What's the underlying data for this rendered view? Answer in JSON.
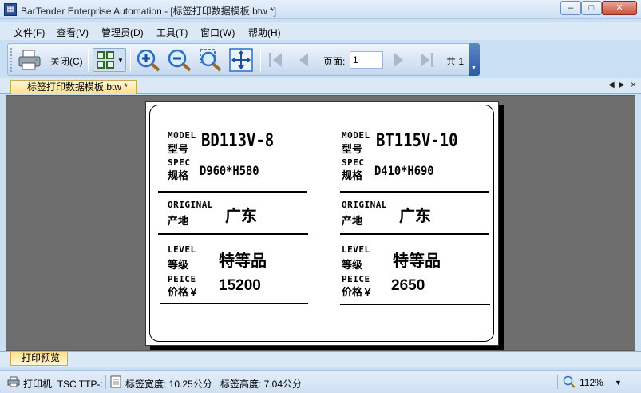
{
  "window": {
    "title": "BarTender Enterprise Automation - [标签打印数据模板.btw *]",
    "app_icon": "bartender-app-icon",
    "minimize": "–",
    "maximize": "□",
    "close": "✕"
  },
  "menu": {
    "items": [
      {
        "label": "文件(F)"
      },
      {
        "label": "查看(V)"
      },
      {
        "label": "管理员(D)"
      },
      {
        "label": "工具(T)"
      },
      {
        "label": "窗口(W)"
      },
      {
        "label": "帮助(H)"
      }
    ]
  },
  "toolbar": {
    "close_label": "关闭(C)",
    "page_label": "页面:",
    "page_value": "1",
    "total_label": "共 1",
    "icons": [
      "print-icon",
      "layout-grid-icon",
      "zoom-in-icon",
      "zoom-out-icon",
      "zoom-fit-icon",
      "fit-page-icon",
      "first-page-icon",
      "prev-page-icon",
      "next-page-icon",
      "last-page-icon"
    ]
  },
  "doc_tab": {
    "label": "标签打印数据模板.btw *"
  },
  "label": {
    "left": {
      "model_en": "MODEL",
      "model_cn": "型号",
      "model_value": "BD113V-8",
      "spec_en": "SPEC",
      "spec_cn": "规格",
      "spec_value": "D960*H580",
      "origin_en": "ORIGINAL",
      "origin_cn": "产地",
      "origin_value": "广东",
      "level_en": "LEVEL",
      "level_cn": "等级",
      "level_value": "特等品",
      "price_en": "PEICE",
      "price_cn": "价格￥",
      "price_value": "15200"
    },
    "right": {
      "model_en": "MODEL",
      "model_cn": "型号",
      "model_value": "BT115V-10",
      "spec_en": "SPEC",
      "spec_cn": "规格",
      "spec_value": "D410*H690",
      "origin_en": "ORIGINAL",
      "origin_cn": "产地",
      "origin_value": "广东",
      "level_en": "LEVEL",
      "level_cn": "等级",
      "level_value": "特等品",
      "price_en": "PEICE",
      "price_cn": "价格￥",
      "price_value": "2650"
    }
  },
  "bottom_tab": {
    "label": "打印预览"
  },
  "status": {
    "printer": "打印机: TSC TTP-:",
    "label_width": "标签宽度: 10.25公分",
    "label_height": "标签高度: 7.04公分",
    "zoom": "112%"
  }
}
